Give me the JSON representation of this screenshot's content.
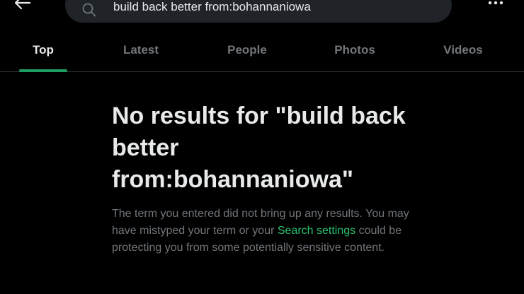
{
  "search": {
    "value": "build back better from:bohannaniowa"
  },
  "tabs": [
    {
      "label": "Top"
    },
    {
      "label": "Latest"
    },
    {
      "label": "People"
    },
    {
      "label": "Photos"
    },
    {
      "label": "Videos"
    }
  ],
  "empty_state": {
    "title": "No results for \"build back better from:bohannaniowa\"",
    "body_before_link": "The term you entered did not bring up any results. You may have mistyped your term or your ",
    "link_text": "Search settings",
    "body_after_link": " could be protecting you from some potentially sensitive content."
  },
  "colors": {
    "background": "#000000",
    "accent": "#1f9c60",
    "link": "#2ac06d",
    "muted": "#71767b",
    "text": "#e7e9ea"
  },
  "icons": {
    "back": "arrow-left-icon",
    "search": "search-icon",
    "more": "more-dots-icon"
  }
}
